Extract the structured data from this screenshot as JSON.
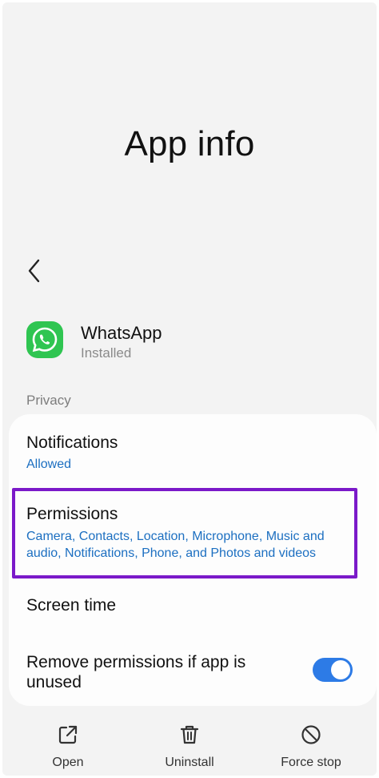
{
  "header": {
    "title": "App info"
  },
  "app": {
    "name": "WhatsApp",
    "status": "Installed"
  },
  "privacy": {
    "section_label": "Privacy",
    "notifications": {
      "title": "Notifications",
      "value": "Allowed"
    },
    "permissions": {
      "title": "Permissions",
      "value_line1": "Camera, Contacts, Location, Microphone, Music and",
      "value_line2": "audio, Notifications, Phone, and Photos and videos"
    },
    "screen_time": {
      "title": "Screen time"
    },
    "remove_permissions": {
      "title_line1": "Remove permissions if app is",
      "title_line2": "unused",
      "enabled": true
    }
  },
  "bottom_bar": {
    "open": "Open",
    "uninstall": "Uninstall",
    "force_stop": "Force stop"
  },
  "colors": {
    "accent_blue": "#1c6fc1",
    "toggle_blue": "#2d7be6",
    "highlight_purple": "#7b19c9",
    "whatsapp_green": "#2fc551"
  }
}
